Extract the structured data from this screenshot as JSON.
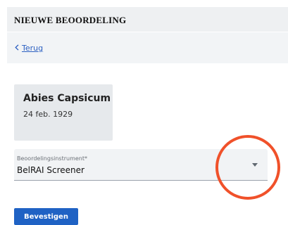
{
  "header": {
    "title": "NIEUWE BEOORDELING"
  },
  "nav": {
    "back_icon": "chevron-left-icon",
    "back_label": "Terug"
  },
  "patient": {
    "name": "Abies Capsicum",
    "birth_date": "24 feb. 1929"
  },
  "instrument_select": {
    "label": "Beoordelingsinstrument*",
    "value": "BelRAI Screener",
    "caret_icon": "caret-down-icon"
  },
  "actions": {
    "confirm_label": "Bevestigen"
  },
  "colors": {
    "accent": "#1f62c4",
    "link": "#2b5fc1",
    "highlight": "#f0512a"
  }
}
